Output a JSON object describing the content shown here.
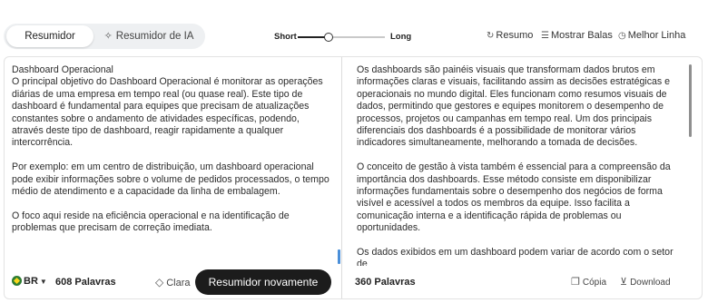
{
  "mode_tabs": {
    "summarizer": "Resumidor",
    "ai_summarizer": "Resumidor de IA"
  },
  "length": {
    "short": "Short",
    "long": "Long",
    "level": 0.35
  },
  "tools": {
    "summary": "Resumo",
    "bullets": "Mostrar Balas",
    "best_line": "Melhor Linha"
  },
  "input": {
    "paragraphs": [
      "Dashboard Operacional\nO principal objetivo do Dashboard Operacional é monitorar as operações diárias de uma empresa em tempo real (ou quase real). Este tipo de dashboard é fundamental para equipes que precisam de atualizações constantes sobre o andamento de atividades específicas, podendo, através deste tipo de dashboard, reagir rapidamente a qualquer intercorrência.",
      "Por exemplo: em um centro de distribuição, um dashboard operacional pode exibir informações sobre o volume de pedidos processados, o tempo médio de atendimento e a capacidade da linha de embalagem.",
      "O foco aqui reside na eficiência operacional e na identificação de problemas que precisam de correção imediata."
    ],
    "language": "BR",
    "word_count": "608 Palavras",
    "clear_label": "Clara",
    "resummarize_label": "Resumidor novamente"
  },
  "output": {
    "paragraphs": [
      "Os dashboards são painéis visuais que transformam dados brutos em informações claras e visuais, facilitando assim as decisões estratégicas e operacionais no mundo digital. Eles funcionam como resumos visuais de dados, permitindo que gestores e equipes monitorem o desempenho de processos, projetos ou campanhas em tempo real. Um dos principais diferenciais dos dashboards é a possibilidade de monitorar vários indicadores simultaneamente, melhorando a tomada de decisões.",
      "O conceito de gestão à vista também é essencial para a compreensão da importância dos dashboards. Esse método consiste em disponibilizar informações fundamentais sobre o desempenho dos negócios de forma visível e acessível a todos os membros da equipe. Isso facilita a comunicação interna e a identificação rápida de problemas ou oportunidades.",
      "Os dados exibidos em um dashboard podem variar de acordo com o setor de"
    ],
    "word_count": "360 Palavras",
    "copy_label": "Cópia",
    "download_label": "Download"
  }
}
